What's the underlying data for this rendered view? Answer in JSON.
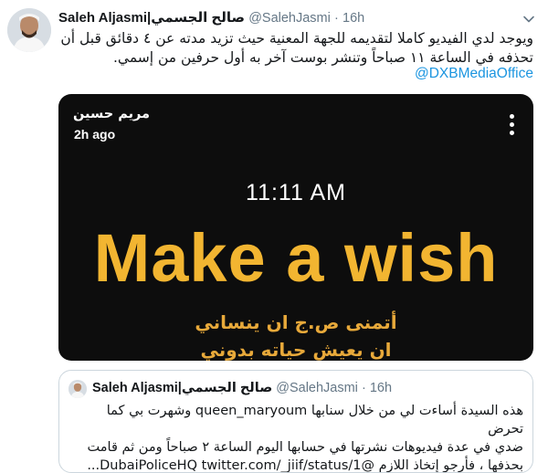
{
  "tweet": {
    "author_name": "Saleh Aljasmi|صالح الجسمي",
    "handle": "@SalehJasmi",
    "separator": "·",
    "time": "16h",
    "text_line1": "ويوجد لدي الفيديو كاملا لتقديمه للجهة المعنية حيث تزيد مدته عن ٤ دقائق قبل أن",
    "text_line2": "تحذفه في الساعة ١١ صباحاً وتنشر بوست آخر به أول حرفين من إسمي.",
    "mention": "@DXBMediaOffice"
  },
  "media": {
    "poster_name": "مريم حسين",
    "posted_ago": "2h ago",
    "clock_text": "11:11 AM",
    "headline": "Make a wish",
    "arabic_line1": "أتمنى ص.ج ان ينساني",
    "arabic_line2": "ان يعيش حياته بدوني"
  },
  "quoted_tweet": {
    "author_name": "Saleh Aljasmi|صالح الجسمي",
    "handle": "@SalehJasmi",
    "separator": "·",
    "time": "16h",
    "text_line1": "هذه السيدة أساءت لي من خلال سنابها queen_maryoum وشهرت بي كما تحرض",
    "text_line2": "ضدي في عدة فيديوهات نشرتها في حسابها اليوم الساعة ٢ صباحاً ومن ثم قامت",
    "text_line3": "بحذفها ، فأرجو إتخاذ اللازم @DubaiPoliceHQ twitter.com/_jiif/status/1..."
  },
  "icons": {
    "caret": "chevron-down-icon",
    "more": "more-vertical-icon"
  }
}
